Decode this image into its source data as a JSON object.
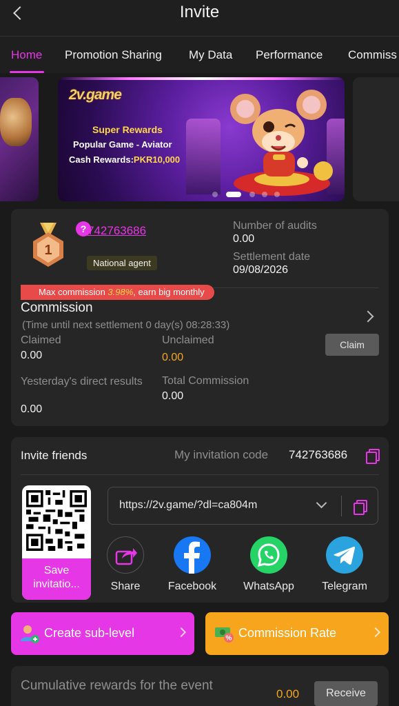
{
  "header": {
    "title": "Invite"
  },
  "tabs": [
    {
      "label": "Home",
      "active": true
    },
    {
      "label": "Promotion Sharing"
    },
    {
      "label": "My Data"
    },
    {
      "label": "Performance"
    },
    {
      "label": "Commiss"
    }
  ],
  "banner": {
    "logo": "2v.game",
    "line1": "Super Rewards",
    "line2": "Popular Game - Aviator",
    "line3_prefix": "Cash Rewards:",
    "line3_value": "PKR10,000",
    "slide_count": 5,
    "active_slide": 3
  },
  "agent": {
    "rank": "1",
    "help_icon": "?",
    "user_id": "742763686",
    "level_badge": "National agent",
    "audits_label": "Number of audits",
    "audits_value": "0.00",
    "settlement_label": "Settlement date",
    "settlement_value": "09/08/2026"
  },
  "commission": {
    "promo_prefix": "Max commission ",
    "promo_percent": "3.98%",
    "promo_suffix": ", earn big monthly",
    "title": "Commission",
    "countdown": "(Time until next settlement  0 day(s) 08:28:33)",
    "claimed_label": "Claimed",
    "claimed_value": "0.00",
    "unclaimed_label": "Unclaimed",
    "unclaimed_value": "0.00",
    "claim_button": "Claim",
    "yesterday_label": "Yesterday's direct results",
    "yesterday_value": "0.00",
    "total_label": "Total Commission",
    "total_value": "0.00"
  },
  "invite": {
    "title": "Invite friends",
    "code_label": "My invitation code",
    "code_value": "742763686",
    "save_label": "Save invitatio...",
    "link": "https://2v.game/?dl=ca804m",
    "share": [
      {
        "label": "Share",
        "icon": "share-icon",
        "color": "#262626"
      },
      {
        "label": "Facebook",
        "icon": "facebook-icon",
        "color": "#1877f2"
      },
      {
        "label": "WhatsApp",
        "icon": "whatsapp-icon",
        "color": "#25d366"
      },
      {
        "label": "Telegram",
        "icon": "telegram-icon",
        "color": "#2aa3de"
      }
    ]
  },
  "actions": {
    "sub_level": "Create sub-level",
    "sub_level_color": "#e637e6",
    "commission_rate": "Commission Rate",
    "commission_rate_color": "#f7a51c"
  },
  "rewards": {
    "label": "Cumulative rewards for the event",
    "value": "0.00",
    "button": "Receive"
  },
  "colors": {
    "accent": "#e637e6",
    "background": "#1a1a1a",
    "panel": "#262626",
    "orange": "#f5a623"
  }
}
